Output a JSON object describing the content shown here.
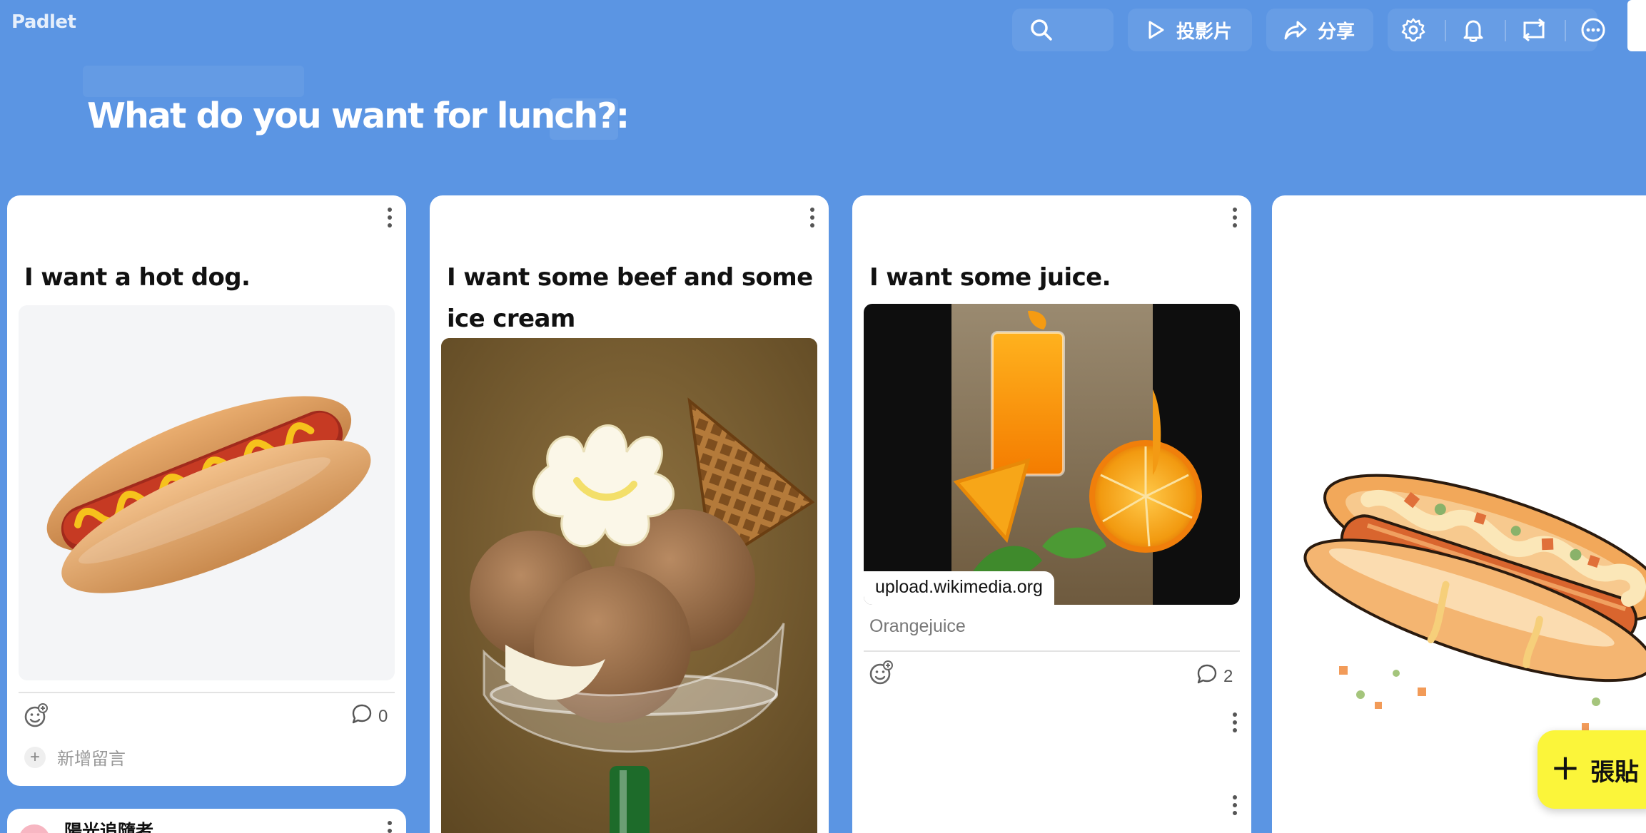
{
  "app": {
    "logo": "Padlet"
  },
  "toolbar": {
    "search_icon": "search-icon",
    "slideshow_label": "投影片",
    "share_label": "分享",
    "icons": [
      "settings-icon",
      "bell-icon",
      "remake-icon",
      "more-icon"
    ]
  },
  "board": {
    "title": "What do you want for lunch?:"
  },
  "posts": [
    {
      "title": "I want a hot dog.",
      "image": "hot-dog-illustration",
      "comment_count": "0",
      "add_comment_label": "新增留言"
    },
    {
      "title": "I want some beef and some ice cream",
      "image": "ice-cream-sundae-photo"
    },
    {
      "title": "I want some juice.",
      "image": "orange-juice-photo",
      "link_domain": "upload.wikimedia.org",
      "caption": "Orangejuice",
      "comment_count": "2"
    },
    {
      "image": "hot-dog-watercolor"
    }
  ],
  "second_row": {
    "author": "陽光追隨者"
  },
  "post_button": {
    "label": "張貼"
  },
  "colors": {
    "background": "#5b95e3",
    "post_button": "#fbf53a",
    "card": "#ffffff"
  }
}
